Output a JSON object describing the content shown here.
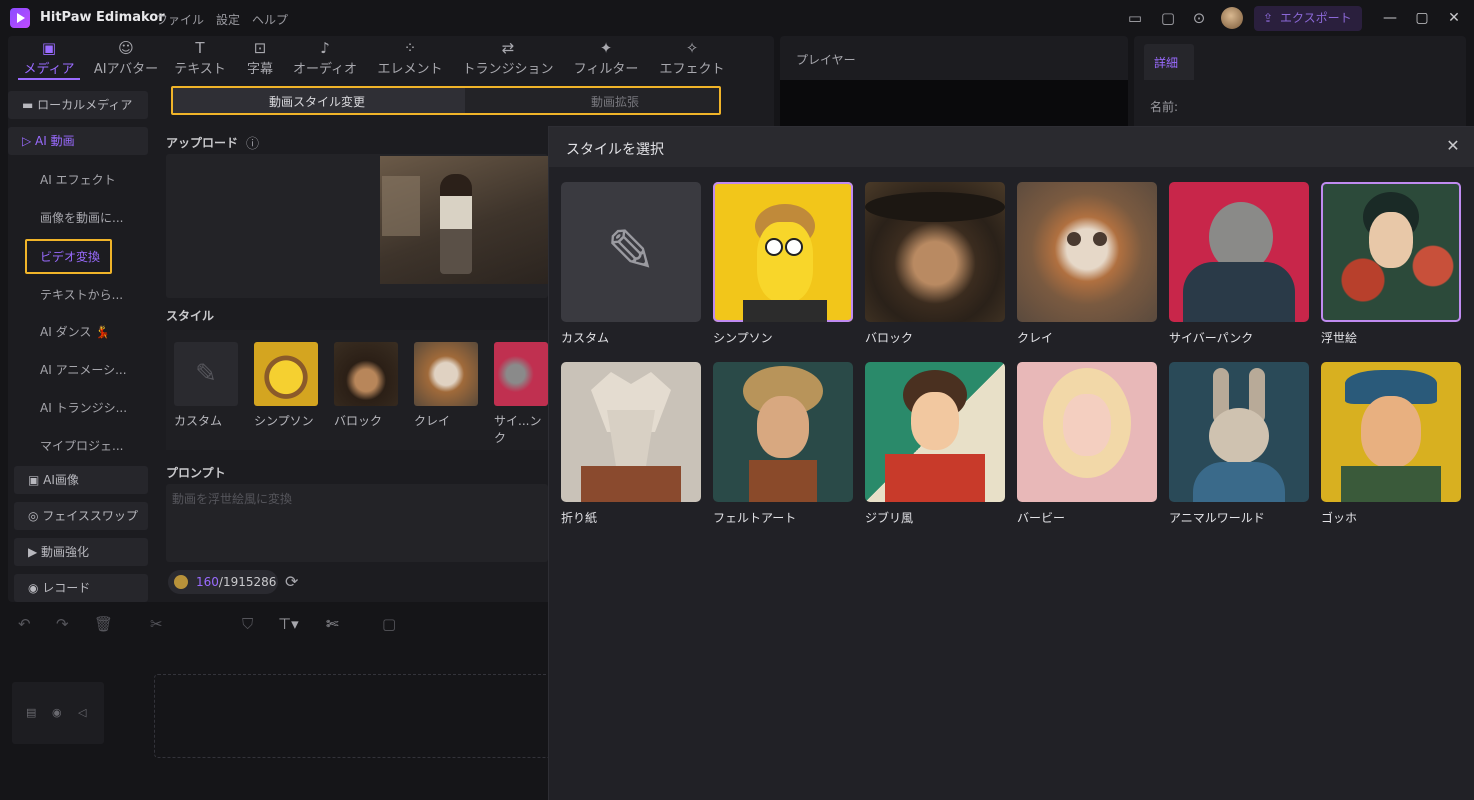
{
  "app": {
    "name": "HitPaw Edimakor",
    "menu": [
      "ファイル",
      "設定",
      "ヘルプ"
    ],
    "export_label": "エクスポート"
  },
  "tool_tabs": [
    {
      "label": "メディア",
      "icon": "media-icon",
      "active": true
    },
    {
      "label": "AIアバター",
      "icon": "avatar-icon"
    },
    {
      "label": "テキスト",
      "icon": "text-icon"
    },
    {
      "label": "字幕",
      "icon": "subtitle-icon"
    },
    {
      "label": "オーディオ",
      "icon": "music-note-icon"
    },
    {
      "label": "エレメント",
      "icon": "elements-icon"
    },
    {
      "label": "トランジション",
      "icon": "transition-icon"
    },
    {
      "label": "フィルター",
      "icon": "filter-icon"
    },
    {
      "label": "エフェクト",
      "icon": "effect-icon"
    }
  ],
  "sidebar": {
    "groups": [
      {
        "label": "ローカルメディア",
        "icon": "folder-icon"
      },
      {
        "label": "AI 動画",
        "icon": "ai-video-icon",
        "active": true
      },
      {
        "label": "AI画像",
        "icon": "ai-image-icon"
      },
      {
        "label": "フェイススワップ",
        "icon": "face-swap-icon"
      },
      {
        "label": "動画強化",
        "icon": "enhance-icon"
      },
      {
        "label": "レコード",
        "icon": "record-icon"
      }
    ],
    "sub_items": [
      "AI エフェクト",
      "画像を動画に...",
      "ビデオ変換",
      "テキストから...",
      "AI ダンス 💃",
      "AI アニメーシ...",
      "AI トランジシ...",
      "マイプロジェ..."
    ]
  },
  "content": {
    "toggle": [
      "動画スタイル変更",
      "動画拡張"
    ],
    "upload_label": "アップロード",
    "style_label": "スタイル",
    "mini_styles": [
      "カスタム",
      "シンプソン",
      "バロック",
      "クレイ",
      "サイ...ンク"
    ],
    "prompt_label": "プロンプト",
    "prompt_placeholder": "動画を浮世絵風に変換",
    "credits_used": "160",
    "credits_total": "/1915286"
  },
  "player": {
    "title": "プレイヤー"
  },
  "detail": {
    "tab": "詳細",
    "name_label": "名前:"
  },
  "modal": {
    "title": "スタイルを選択",
    "styles": [
      {
        "label": "カスタム",
        "selected": false
      },
      {
        "label": "シンプソン",
        "selected": true
      },
      {
        "label": "バロック",
        "selected": false
      },
      {
        "label": "クレイ",
        "selected": false
      },
      {
        "label": "サイバーパンク",
        "selected": false
      },
      {
        "label": "浮世絵",
        "selected": true
      },
      {
        "label": "折り紙",
        "selected": false
      },
      {
        "label": "フェルトアート",
        "selected": false
      },
      {
        "label": "ジブリ風",
        "selected": false
      },
      {
        "label": "バービー",
        "selected": false
      },
      {
        "label": "アニマルワールド",
        "selected": false
      },
      {
        "label": "ゴッホ",
        "selected": false
      }
    ]
  },
  "colors": {
    "accent": "#9a6bff",
    "highlight": "#f0b429",
    "selected_border": "#c08bf0"
  }
}
